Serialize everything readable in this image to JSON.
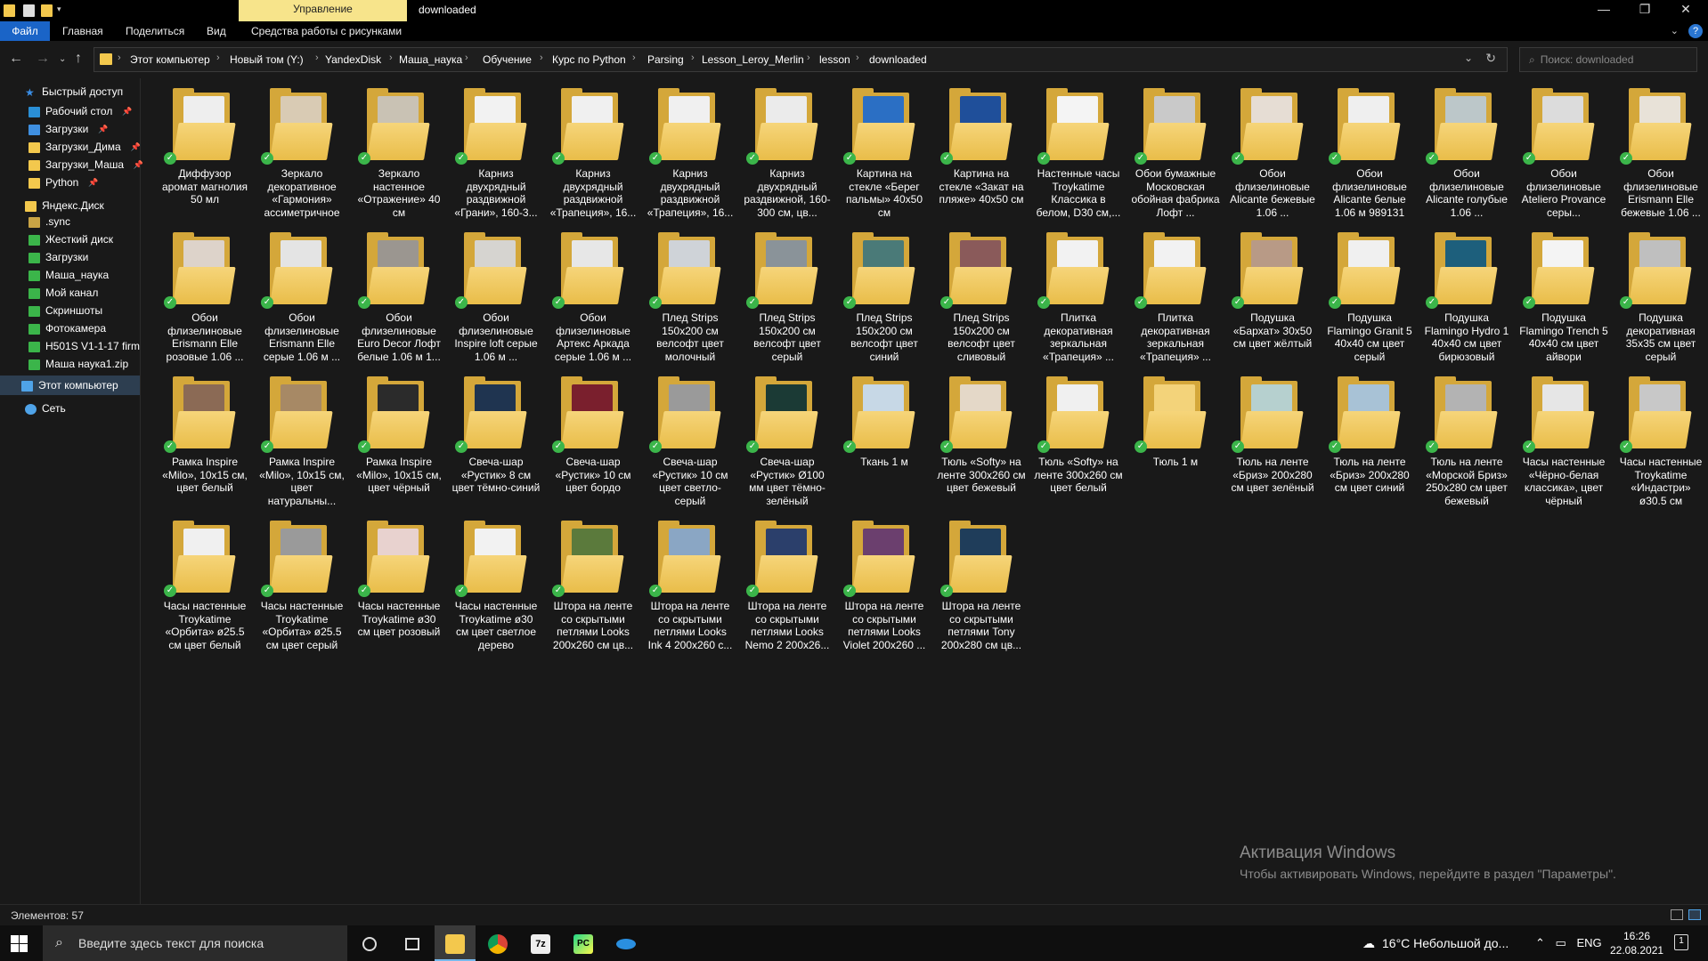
{
  "titlebar": {
    "manage_tab": "Управление",
    "title": "downloaded",
    "minimize": "—",
    "maximize": "❐",
    "close": "✕"
  },
  "ribbon": {
    "tabs": [
      "Файл",
      "Главная",
      "Поделиться",
      "Вид",
      "Средства работы с рисунками"
    ],
    "help": "?"
  },
  "addressbar": {
    "crumbs": [
      "Этот компьютер",
      "Новый том (Y:)",
      "YandexDisk",
      "Маша_наука",
      "Обучение",
      "Курс по Python",
      "Parsing",
      "Lesson_Leroy_Merlin",
      "lesson",
      "downloaded"
    ],
    "search_placeholder": "Поиск: downloaded"
  },
  "sidebar": {
    "items": [
      {
        "label": "Быстрый доступ",
        "icon": "star-icon",
        "color": "#3a8ee6",
        "pinned": false
      },
      {
        "label": "Рабочий стол",
        "icon": "desktop-icon",
        "color": "#2a8fd6",
        "pinned": true
      },
      {
        "label": "Загрузки",
        "icon": "download-icon",
        "color": "#3f8fe0",
        "pinned": true
      },
      {
        "label": "Загрузки_Дима",
        "icon": "folder-icon",
        "color": "#f3c84d",
        "pinned": true
      },
      {
        "label": "Загрузки_Маша",
        "icon": "folder-icon",
        "color": "#f3c84d",
        "pinned": true
      },
      {
        "label": "Python",
        "icon": "folder-icon",
        "color": "#f3c84d",
        "pinned": true
      },
      {
        "label": "Яндекс.Диск",
        "icon": "yandex-disk-icon",
        "color": "#f3c84d",
        "pinned": false
      },
      {
        "label": ".sync",
        "icon": "folder-icon",
        "color": "#c9a445",
        "pinned": false
      },
      {
        "label": "Жесткий диск",
        "icon": "folder-sync-icon",
        "color": "#3bb54a",
        "pinned": false
      },
      {
        "label": "Загрузки",
        "icon": "folder-sync-icon",
        "color": "#3bb54a",
        "pinned": false
      },
      {
        "label": "Маша_наука",
        "icon": "folder-sync-icon",
        "color": "#3bb54a",
        "pinned": false
      },
      {
        "label": "Мой канал",
        "icon": "folder-sync-icon",
        "color": "#3bb54a",
        "pinned": false
      },
      {
        "label": "Скриншоты",
        "icon": "folder-sync-icon",
        "color": "#3bb54a",
        "pinned": false
      },
      {
        "label": "Фотокамера",
        "icon": "folder-sync-icon",
        "color": "#3bb54a",
        "pinned": false
      },
      {
        "label": "H501S V1-1-17 firm",
        "icon": "zip-icon",
        "color": "#3bb54a",
        "pinned": false
      },
      {
        "label": "Маша наука1.zip",
        "icon": "zip-icon",
        "color": "#3bb54a",
        "pinned": false
      },
      {
        "label": "Этот компьютер",
        "icon": "computer-icon",
        "color": "#4fa3e8",
        "pinned": false
      },
      {
        "label": "Сеть",
        "icon": "network-icon",
        "color": "#4fa3e8",
        "pinned": false
      }
    ]
  },
  "files": [
    {
      "label": "Диффузор аромат магнолия 50 мл",
      "thumb": "#eeeeee"
    },
    {
      "label": "Зеркало декоративное «Гармония» ассиметричное",
      "thumb": "#d9cbb4"
    },
    {
      "label": "Зеркало настенное «Отражение» 40 см",
      "thumb": "#c9c2b4"
    },
    {
      "label": "Карниз двухрядный раздвижной «Грани», 160-3...",
      "thumb": "#f2f2f2"
    },
    {
      "label": "Карниз двухрядный раздвижной «Трапеция», 16...",
      "thumb": "#f0f0f0"
    },
    {
      "label": "Карниз двухрядный раздвижной «Трапеция», 16...",
      "thumb": "#f0f0f0"
    },
    {
      "label": "Карниз двухрядный раздвижной, 160-300 см, цв...",
      "thumb": "#ebebeb"
    },
    {
      "label": "Картина на стекле «Берег пальмы» 40х50 см",
      "thumb": "#2b6fc4"
    },
    {
      "label": "Картина на стекле «Закат на пляже» 40х50 см",
      "thumb": "#1f4f9a"
    },
    {
      "label": "Настенные часы Troykatime Классика в белом, D30 см,...",
      "thumb": "#f4f4f4"
    },
    {
      "label": "Обои бумажные Московская обойная фабрика Лофт ...",
      "thumb": "#c9c9c9"
    },
    {
      "label": "Обои флизелиновые Alicante бежевые 1.06 ...",
      "thumb": "#e6ddd4"
    },
    {
      "label": "Обои флизелиновые Alicante белые 1.06 м 989131",
      "thumb": "#efefef"
    },
    {
      "label": "Обои флизелиновые Alicante голубые 1.06 ...",
      "thumb": "#bcc7c9"
    },
    {
      "label": "Обои флизелиновые Ateliero Provance серы...",
      "thumb": "#dcdcdc"
    },
    {
      "label": "Обои флизелиновые Erismann Elle бежевые 1.06 ...",
      "thumb": "#e8e2d8"
    },
    {
      "label": "Обои флизелиновые Erismann Elle розовые 1.06 ...",
      "thumb": "#ddd3ca"
    },
    {
      "label": "Обои флизелиновые Erismann Elle серые 1.06 м ...",
      "thumb": "#e4e4e4"
    },
    {
      "label": "Обои флизелиновые Euro Decor Лофт белые 1.06 м 1...",
      "thumb": "#9b9690"
    },
    {
      "label": "Обои флизелиновые Inspire loft серые 1.06 м ...",
      "thumb": "#d6d4d0"
    },
    {
      "label": "Обои флизелиновые Артекс Аркада серые 1.06 м ...",
      "thumb": "#e7e7e7"
    },
    {
      "label": "Плед Strips 150х200 см велсофт цвет молочный",
      "thumb": "#cfd3d8"
    },
    {
      "label": "Плед Strips 150х200 см велсофт цвет серый",
      "thumb": "#8a9399"
    },
    {
      "label": "Плед Strips 150х200 см велсофт цвет синий",
      "thumb": "#4a7a78"
    },
    {
      "label": "Плед Strips 150х200 см велсофт цвет сливовый",
      "thumb": "#8a5a5a"
    },
    {
      "label": "Плитка декоративная зеркальная «Трапеция» ...",
      "thumb": "#f2f2f2"
    },
    {
      "label": "Плитка декоративная зеркальная «Трапеция» ...",
      "thumb": "#f2f2f2"
    },
    {
      "label": "Подушка «Бархат» 30х50 см цвет жёлтый",
      "thumb": "#b89a86"
    },
    {
      "label": "Подушка Flamingo Granit 5 40х40 см цвет серый",
      "thumb": "#f0f0f0"
    },
    {
      "label": "Подушка Flamingo Hydro 1 40х40 см цвет бирюзовый",
      "thumb": "#1d5f7c"
    },
    {
      "label": "Подушка Flamingo Trench 5 40х40 см цвет айвори",
      "thumb": "#f4f4f4"
    },
    {
      "label": "Подушка декоративная 35х35 см цвет серый",
      "thumb": "#bfbfbf"
    },
    {
      "label": "Рамка Inspire «Milo», 10х15 см, цвет белый",
      "thumb": "#8b6a55"
    },
    {
      "label": "Рамка Inspire «Milo», 10х15 см, цвет натуральны...",
      "thumb": "#a78965"
    },
    {
      "label": "Рамка Inspire «Milo», 10х15 см, цвет чёрный",
      "thumb": "#2b2b2b"
    },
    {
      "label": "Свеча-шар «Рустик» 8 см цвет тёмно-синий",
      "thumb": "#1f3450"
    },
    {
      "label": "Свеча-шар «Рустик» 10 см цвет бордо",
      "thumb": "#7a1f2d"
    },
    {
      "label": "Свеча-шар «Рустик» 10 см цвет светло-серый",
      "thumb": "#9a9a9a"
    },
    {
      "label": "Свеча-шар «Рустик» Ø100 мм цвет тёмно-зелёный",
      "thumb": "#1b3a35"
    },
    {
      "label": "Ткань 1 м",
      "thumb": "#c7d8e6"
    },
    {
      "label": "Тюль «Softy» на ленте 300х260 см цвет бежевый",
      "thumb": "#e4d8c8"
    },
    {
      "label": "Тюль «Softy» на ленте 300х260 см цвет белый",
      "thumb": "#f0f0f0"
    },
    {
      "label": "Тюль 1 м",
      "thumb": "#f3d37a"
    },
    {
      "label": "Тюль на ленте «Бриз» 200х280 см цвет зелёный",
      "thumb": "#b6d0cf"
    },
    {
      "label": "Тюль на ленте «Бриз» 200х280 см цвет синий",
      "thumb": "#a8c2d6"
    },
    {
      "label": "Тюль на ленте «Морской Бриз» 250х280 см цвет бежевый",
      "thumb": "#b3b3b3"
    },
    {
      "label": "Часы настенные «Чёрно-белая классика», цвет чёрный",
      "thumb": "#e6e6e6"
    },
    {
      "label": "Часы настенные Troykatime «Индастри» ø30.5 см",
      "thumb": "#c8c8c8"
    },
    {
      "label": "Часы настенные Troykatime «Орбита» ø25.5 см цвет белый",
      "thumb": "#f0f0f0"
    },
    {
      "label": "Часы настенные Troykatime «Орбита» ø25.5 см цвет серый",
      "thumb": "#9a9a9a"
    },
    {
      "label": "Часы настенные Troykatime ø30 см цвет розовый",
      "thumb": "#e8d2cf"
    },
    {
      "label": "Часы настенные Troykatime ø30 см цвет светлое дерево",
      "thumb": "#f2f2f2"
    },
    {
      "label": "Штора на ленте со скрытыми петлями Looks 200х260 см цв...",
      "thumb": "#5b7a3c"
    },
    {
      "label": "Штора на ленте со скрытыми петлями Looks Ink 4 200х260 с...",
      "thumb": "#8aa6c4"
    },
    {
      "label": "Штора на ленте со скрытыми петлями Looks Nemo 2 200х26...",
      "thumb": "#2b3f6b"
    },
    {
      "label": "Штора на ленте со скрытыми петлями Looks Violet 200х260 ...",
      "thumb": "#6b3f6e"
    },
    {
      "label": "Штора на ленте со скрытыми петлями Tony 200х280 см цв...",
      "thumb": "#1f3d5a"
    }
  ],
  "watermark": {
    "title": "Активация Windows",
    "subtitle": "Чтобы активировать Windows, перейдите в раздел \"Параметры\"."
  },
  "status": {
    "count": "Элементов: 57"
  },
  "taskbar": {
    "search_placeholder": "Введите здесь текст для поиска",
    "weather": "16°C  Небольшой до...",
    "lang": "ENG",
    "time": "16:26",
    "date": "22.08.2021"
  }
}
